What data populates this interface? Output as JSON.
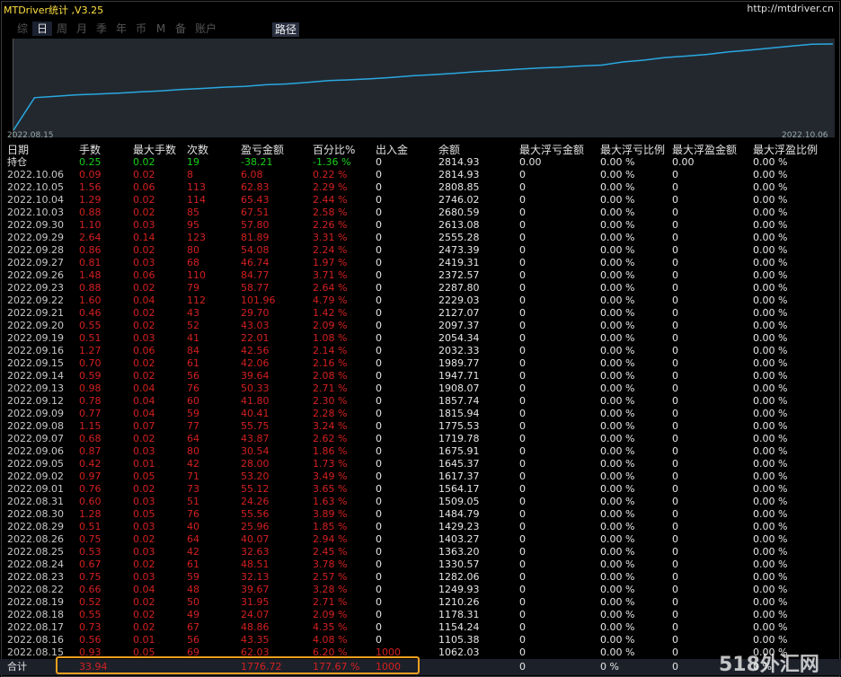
{
  "window": {
    "title": "MTDriver统计 ,V3.25",
    "url": "http://mtdriver.cn"
  },
  "tabs": [
    "综",
    "日",
    "周",
    "月",
    "季",
    "年",
    "币",
    "M",
    "备",
    "账户"
  ],
  "active_tab": "日",
  "path_tab": "路径",
  "chart": {
    "start_date": "2022.08.15",
    "end_date": "2022.10.06",
    "line_color": "#2aa8e0"
  },
  "columns": [
    "日期",
    "手数",
    "最大手数",
    "次数",
    "盈亏金额",
    "百分比%",
    "出入金",
    "余额",
    "最大浮亏金额",
    "最大浮亏比例",
    "最大浮盈金额",
    "最大浮盈比例"
  ],
  "holding": [
    "持仓",
    "0.25",
    "0.02",
    "19",
    "-38.21",
    "-1.36 %",
    "0",
    "2814.93",
    "0.00",
    "0.00 %",
    "0.00",
    "0.00 %"
  ],
  "rows": [
    [
      "2022.10.06",
      "0.09",
      "0.02",
      "8",
      "6.08",
      "0.22 %",
      "0",
      "2814.93",
      "0",
      "0.00 %",
      "0",
      "0.00 %"
    ],
    [
      "2022.10.05",
      "1.56",
      "0.06",
      "113",
      "62.83",
      "2.29 %",
      "0",
      "2808.85",
      "0",
      "0.00 %",
      "0",
      "0.00 %"
    ],
    [
      "2022.10.04",
      "1.29",
      "0.02",
      "114",
      "65.43",
      "2.44 %",
      "0",
      "2746.02",
      "0",
      "0.00 %",
      "0",
      "0.00 %"
    ],
    [
      "2022.10.03",
      "0.88",
      "0.02",
      "85",
      "67.51",
      "2.58 %",
      "0",
      "2680.59",
      "0",
      "0.00 %",
      "0",
      "0.00 %"
    ],
    [
      "2022.09.30",
      "1.10",
      "0.03",
      "95",
      "57.80",
      "2.26 %",
      "0",
      "2613.08",
      "0",
      "0.00 %",
      "0",
      "0.00 %"
    ],
    [
      "2022.09.29",
      "2.64",
      "0.14",
      "123",
      "81.89",
      "3.31 %",
      "0",
      "2555.28",
      "0",
      "0.00 %",
      "0",
      "0.00 %"
    ],
    [
      "2022.09.28",
      "0.86",
      "0.02",
      "80",
      "54.08",
      "2.24 %",
      "0",
      "2473.39",
      "0",
      "0.00 %",
      "0",
      "0.00 %"
    ],
    [
      "2022.09.27",
      "0.81",
      "0.03",
      "68",
      "46.74",
      "1.97 %",
      "0",
      "2419.31",
      "0",
      "0.00 %",
      "0",
      "0.00 %"
    ],
    [
      "2022.09.26",
      "1.48",
      "0.06",
      "110",
      "84.77",
      "3.71 %",
      "0",
      "2372.57",
      "0",
      "0.00 %",
      "0",
      "0.00 %"
    ],
    [
      "2022.09.23",
      "0.88",
      "0.02",
      "79",
      "58.77",
      "2.64 %",
      "0",
      "2287.80",
      "0",
      "0.00 %",
      "0",
      "0.00 %"
    ],
    [
      "2022.09.22",
      "1.60",
      "0.04",
      "112",
      "101.96",
      "4.79 %",
      "0",
      "2229.03",
      "0",
      "0.00 %",
      "0",
      "0.00 %"
    ],
    [
      "2022.09.21",
      "0.46",
      "0.02",
      "43",
      "29.70",
      "1.42 %",
      "0",
      "2127.07",
      "0",
      "0.00 %",
      "0",
      "0.00 %"
    ],
    [
      "2022.09.20",
      "0.55",
      "0.02",
      "52",
      "43.03",
      "2.09 %",
      "0",
      "2097.37",
      "0",
      "0.00 %",
      "0",
      "0.00 %"
    ],
    [
      "2022.09.19",
      "0.51",
      "0.03",
      "41",
      "22.01",
      "1.08 %",
      "0",
      "2054.34",
      "0",
      "0.00 %",
      "0",
      "0.00 %"
    ],
    [
      "2022.09.16",
      "1.27",
      "0.06",
      "84",
      "42.56",
      "2.14 %",
      "0",
      "2032.33",
      "0",
      "0.00 %",
      "0",
      "0.00 %"
    ],
    [
      "2022.09.15",
      "0.70",
      "0.02",
      "61",
      "42.06",
      "2.16 %",
      "0",
      "1989.77",
      "0",
      "0.00 %",
      "0",
      "0.00 %"
    ],
    [
      "2022.09.14",
      "0.59",
      "0.02",
      "56",
      "39.64",
      "2.08 %",
      "0",
      "1947.71",
      "0",
      "0.00 %",
      "0",
      "0.00 %"
    ],
    [
      "2022.09.13",
      "0.98",
      "0.04",
      "76",
      "50.33",
      "2.71 %",
      "0",
      "1908.07",
      "0",
      "0.00 %",
      "0",
      "0.00 %"
    ],
    [
      "2022.09.12",
      "0.78",
      "0.04",
      "60",
      "41.80",
      "2.30 %",
      "0",
      "1857.74",
      "0",
      "0.00 %",
      "0",
      "0.00 %"
    ],
    [
      "2022.09.09",
      "0.77",
      "0.04",
      "59",
      "40.41",
      "2.28 %",
      "0",
      "1815.94",
      "0",
      "0.00 %",
      "0",
      "0.00 %"
    ],
    [
      "2022.09.08",
      "1.15",
      "0.07",
      "77",
      "55.75",
      "3.24 %",
      "0",
      "1775.53",
      "0",
      "0.00 %",
      "0",
      "0.00 %"
    ],
    [
      "2022.09.07",
      "0.68",
      "0.02",
      "64",
      "43.87",
      "2.62 %",
      "0",
      "1719.78",
      "0",
      "0.00 %",
      "0",
      "0.00 %"
    ],
    [
      "2022.09.06",
      "0.87",
      "0.03",
      "80",
      "30.54",
      "1.86 %",
      "0",
      "1675.91",
      "0",
      "0.00 %",
      "0",
      "0.00 %"
    ],
    [
      "2022.09.05",
      "0.42",
      "0.01",
      "42",
      "28.00",
      "1.73 %",
      "0",
      "1645.37",
      "0",
      "0.00 %",
      "0",
      "0.00 %"
    ],
    [
      "2022.09.02",
      "0.97",
      "0.05",
      "71",
      "53.20",
      "3.49 %",
      "0",
      "1617.37",
      "0",
      "0.00 %",
      "0",
      "0.00 %"
    ],
    [
      "2022.09.01",
      "0.76",
      "0.02",
      "73",
      "55.12",
      "3.65 %",
      "0",
      "1564.17",
      "0",
      "0.00 %",
      "0",
      "0.00 %"
    ],
    [
      "2022.08.31",
      "0.60",
      "0.03",
      "51",
      "24.26",
      "1.63 %",
      "0",
      "1509.05",
      "0",
      "0.00 %",
      "0",
      "0.00 %"
    ],
    [
      "2022.08.30",
      "1.28",
      "0.05",
      "76",
      "55.56",
      "3.89 %",
      "0",
      "1484.79",
      "0",
      "0.00 %",
      "0",
      "0.00 %"
    ],
    [
      "2022.08.29",
      "0.51",
      "0.03",
      "40",
      "25.96",
      "1.85 %",
      "0",
      "1429.23",
      "0",
      "0.00 %",
      "0",
      "0.00 %"
    ],
    [
      "2022.08.26",
      "0.75",
      "0.02",
      "64",
      "40.07",
      "2.94 %",
      "0",
      "1403.27",
      "0",
      "0.00 %",
      "0",
      "0.00 %"
    ],
    [
      "2022.08.25",
      "0.53",
      "0.03",
      "42",
      "32.63",
      "2.45 %",
      "0",
      "1363.20",
      "0",
      "0.00 %",
      "0",
      "0.00 %"
    ],
    [
      "2022.08.24",
      "0.67",
      "0.02",
      "61",
      "48.51",
      "3.78 %",
      "0",
      "1330.57",
      "0",
      "0.00 %",
      "0",
      "0.00 %"
    ],
    [
      "2022.08.23",
      "0.75",
      "0.03",
      "59",
      "32.13",
      "2.57 %",
      "0",
      "1282.06",
      "0",
      "0.00 %",
      "0",
      "0.00 %"
    ],
    [
      "2022.08.22",
      "0.66",
      "0.04",
      "48",
      "39.67",
      "3.28 %",
      "0",
      "1249.93",
      "0",
      "0.00 %",
      "0",
      "0.00 %"
    ],
    [
      "2022.08.19",
      "0.52",
      "0.02",
      "50",
      "31.95",
      "2.71 %",
      "0",
      "1210.26",
      "0",
      "0.00 %",
      "0",
      "0.00 %"
    ],
    [
      "2022.08.18",
      "0.55",
      "0.02",
      "49",
      "24.07",
      "2.09 %",
      "0",
      "1178.31",
      "0",
      "0.00 %",
      "0",
      "0.00 %"
    ],
    [
      "2022.08.17",
      "0.73",
      "0.02",
      "67",
      "48.86",
      "4.35 %",
      "0",
      "1154.24",
      "0",
      "0.00 %",
      "0",
      "0.00 %"
    ],
    [
      "2022.08.16",
      "0.56",
      "0.01",
      "56",
      "43.35",
      "4.08 %",
      "0",
      "1105.38",
      "0",
      "0.00 %",
      "0",
      "0.00 %"
    ],
    [
      "2022.08.15",
      "0.93",
      "0.05",
      "69",
      "62.03",
      "6.20 %",
      "1000",
      "1062.03",
      "0",
      "0.00 %",
      "0",
      "0.00 %"
    ]
  ],
  "total": [
    "合计",
    "33.94",
    "",
    "",
    "1776.72",
    "177.67 %",
    "1000",
    "",
    "0",
    "0 %",
    "0",
    "0 %"
  ],
  "watermark": "518外汇网"
}
